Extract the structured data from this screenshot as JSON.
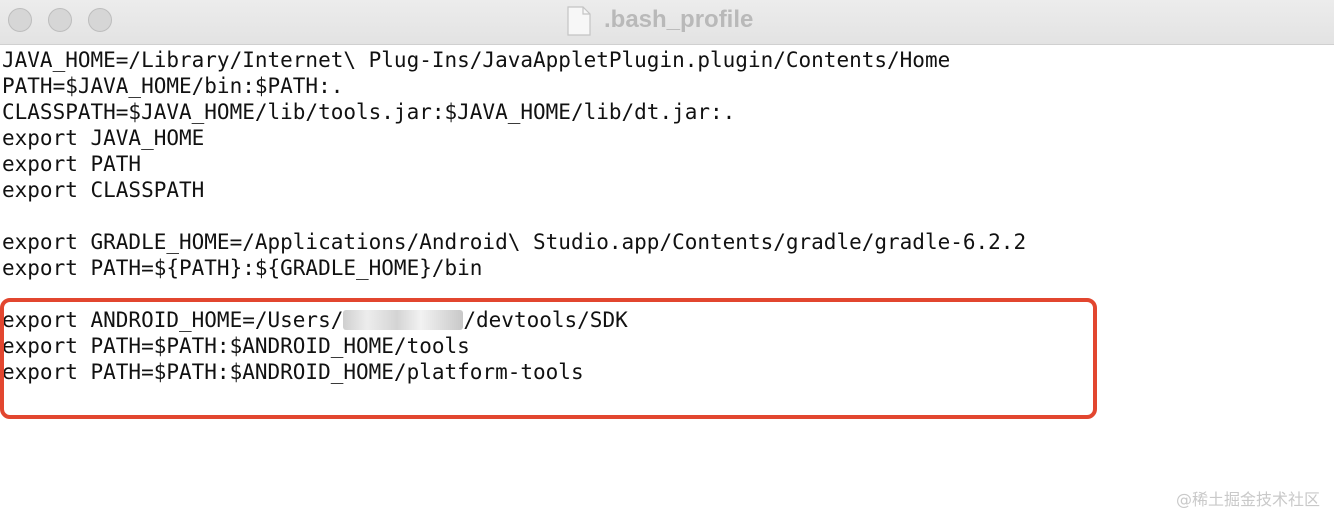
{
  "window": {
    "title": ".bash_profile",
    "controls": [
      "close",
      "minimize",
      "zoom"
    ],
    "icon": "document-icon"
  },
  "editor": {
    "lines": [
      {
        "text": "JAVA_HOME=/Library/Internet\\ Plug-Ins/JavaAppletPlugin.plugin/Contents/Home"
      },
      {
        "text": "PATH=$JAVA_HOME/bin:$PATH:."
      },
      {
        "text": "CLASSPATH=$JAVA_HOME/lib/tools.jar:$JAVA_HOME/lib/dt.jar:."
      },
      {
        "text": "export JAVA_HOME"
      },
      {
        "text": "export PATH"
      },
      {
        "text": "export CLASSPATH"
      },
      {
        "text": ""
      },
      {
        "text": "export GRADLE_HOME=/Applications/Android\\ Studio.app/Contents/gradle/gradle-6.2.2"
      },
      {
        "text": "export PATH=${PATH}:${GRADLE_HOME}/bin"
      },
      {
        "text": ""
      },
      {
        "text_before": "export ANDROID_HOME=/Users/",
        "redacted": true,
        "text_after": "/devtools/SDK"
      },
      {
        "text": "export PATH=$PATH:$ANDROID_HOME/tools"
      },
      {
        "text": "export PATH=$PATH:$ANDROID_HOME/platform-tools"
      }
    ]
  },
  "colors": {
    "highlight_border": "#e2462f",
    "spellcheck_underline": "#e0554a"
  },
  "watermark": "@稀土掘金技术社区"
}
